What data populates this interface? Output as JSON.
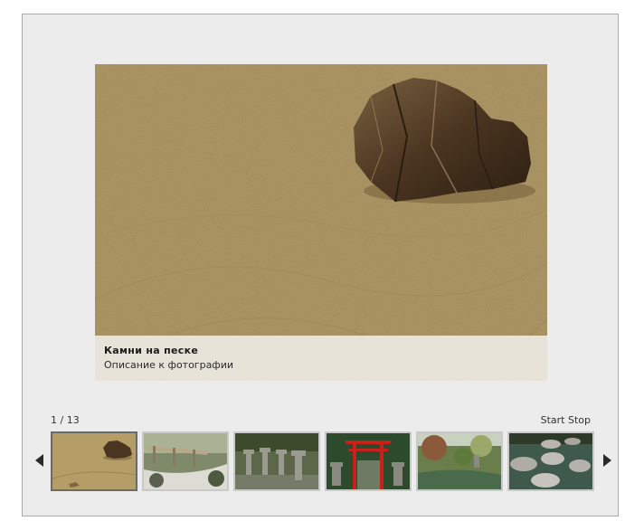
{
  "photo": {
    "title": "Камни на песке",
    "description": "Описание к фотографии"
  },
  "counter": {
    "text": "1 / 13"
  },
  "controls": {
    "start_label": "Start",
    "stop_label": "Stop"
  },
  "thumbnails": [
    {
      "subject": "rock-on-sand"
    },
    {
      "subject": "garden-bridge"
    },
    {
      "subject": "stone-lanterns"
    },
    {
      "subject": "red-torii-gate"
    },
    {
      "subject": "garden-pond"
    },
    {
      "subject": "stepping-stones"
    }
  ],
  "icons": {
    "prev": "arrow-left-icon",
    "next": "arrow-right-icon"
  }
}
